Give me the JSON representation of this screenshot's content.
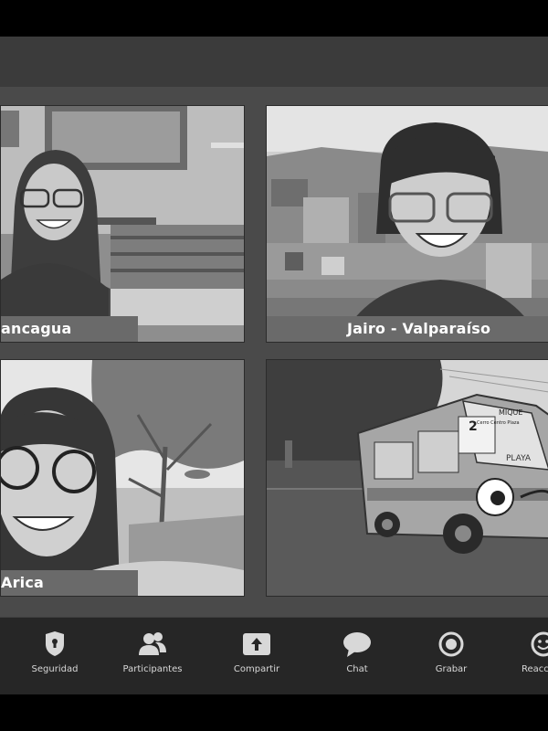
{
  "participants": [
    {
      "name": "ancagua"
    },
    {
      "name": "Jairo - Valparaíso"
    },
    {
      "name": "Arica"
    },
    {
      "name": ""
    }
  ],
  "bus_sign": {
    "route": "MIQUE",
    "number": "2",
    "destination": "PLAYA",
    "via": "Cerro Centro Plaza"
  },
  "toolbar": [
    {
      "label": "Seguridad",
      "icon": "shield-icon"
    },
    {
      "label": "Participantes",
      "icon": "participants-icon"
    },
    {
      "label": "Compartir",
      "icon": "share-screen-icon"
    },
    {
      "label": "Chat",
      "icon": "chat-icon"
    },
    {
      "label": "Grabar",
      "icon": "record-icon"
    },
    {
      "label": "Reacci",
      "icon": "reactions-icon"
    }
  ],
  "colors": {
    "nameplate": "#6a6a6a",
    "toolbar": "#262626",
    "gallery": "#4a4a4a"
  }
}
